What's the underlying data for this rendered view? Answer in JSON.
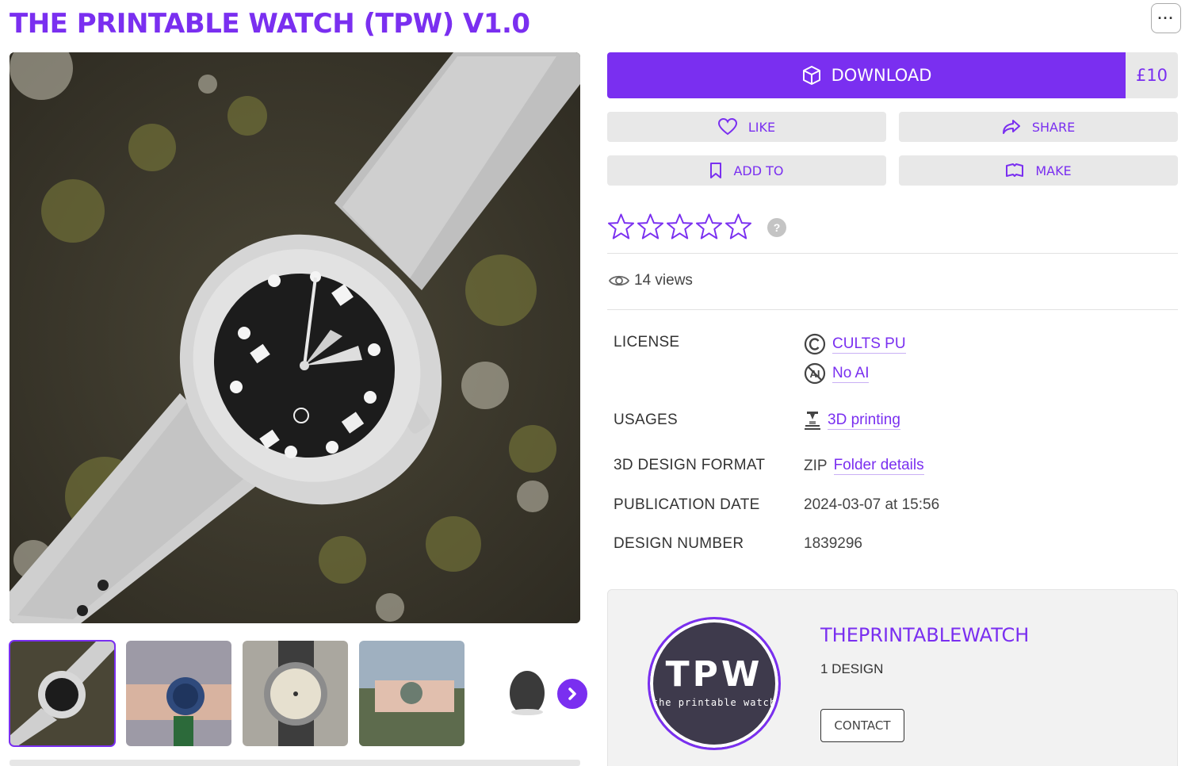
{
  "page": {
    "title": "THE PRINTABLE WATCH (TPW) V1.0"
  },
  "actions": {
    "download_label": "DOWNLOAD",
    "price": "£10",
    "like_label": "LIKE",
    "share_label": "SHARE",
    "add_to_label": "ADD TO",
    "make_label": "MAKE",
    "more_icon": "ellipsis-icon"
  },
  "rating": {
    "stars_total": 5,
    "stars_filled": 0,
    "help": "?"
  },
  "stats": {
    "views": "14 views"
  },
  "details": {
    "license_label": "LICENSE",
    "license_value": "CULTS PU",
    "ai_value": "No AI",
    "usages_label": "USAGES",
    "usages_value": "3D printing",
    "format_label": "3D DESIGN FORMAT",
    "format_value": "ZIP",
    "format_link": "Folder details",
    "pubdate_label": "PUBLICATION DATE",
    "pubdate_value": "2024-03-07 at 15:56",
    "number_label": "DESIGN NUMBER",
    "number_value": "1839296"
  },
  "author": {
    "name": "THEPRINTABLEWATCH",
    "designs": "1 DESIGN",
    "contact_label": "CONTACT",
    "logo_text": "TPW",
    "logo_sub": "the printable watch"
  },
  "colors": {
    "accent": "#7a2ff0",
    "button_bg": "#e8e8e8"
  }
}
